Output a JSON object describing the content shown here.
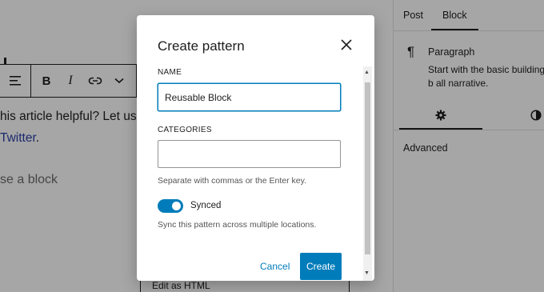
{
  "editor": {
    "text_line1": "his article helpful? Let us k",
    "text_line2_link": "Twitter",
    "text_line2_suffix": ".",
    "hint": "se a block",
    "dropdown_item": "Edit as HTML",
    "toolbar": {
      "align_icon": "align-left-icon",
      "bold": "B",
      "italic": "I",
      "link_icon": "link-icon",
      "more_icon": "chevron-down-icon"
    }
  },
  "sidebar": {
    "tabs": [
      "Post",
      "Block"
    ],
    "active_tab": "Block",
    "block_icon": "paragraph-icon",
    "block_title": "Paragraph",
    "block_description": "Start with the basic building b all narrative.",
    "subtabs": [
      "settings-gear-icon",
      "styles-contrast-icon"
    ],
    "advanced_label": "Advanced"
  },
  "modal": {
    "title": "Create pattern",
    "name_label": "NAME",
    "name_value": "Reusable Block",
    "categories_label": "CATEGORIES",
    "categories_value": "",
    "categories_help": "Separate with commas or the Enter key.",
    "synced_label": "Synced",
    "synced_on": true,
    "synced_help": "Sync this pattern across multiple locations.",
    "cancel_label": "Cancel",
    "create_label": "Create"
  },
  "colors": {
    "accent": "#007cba",
    "overlay": "rgba(0,0,0,0.35)",
    "link": "#2a3ea8"
  }
}
